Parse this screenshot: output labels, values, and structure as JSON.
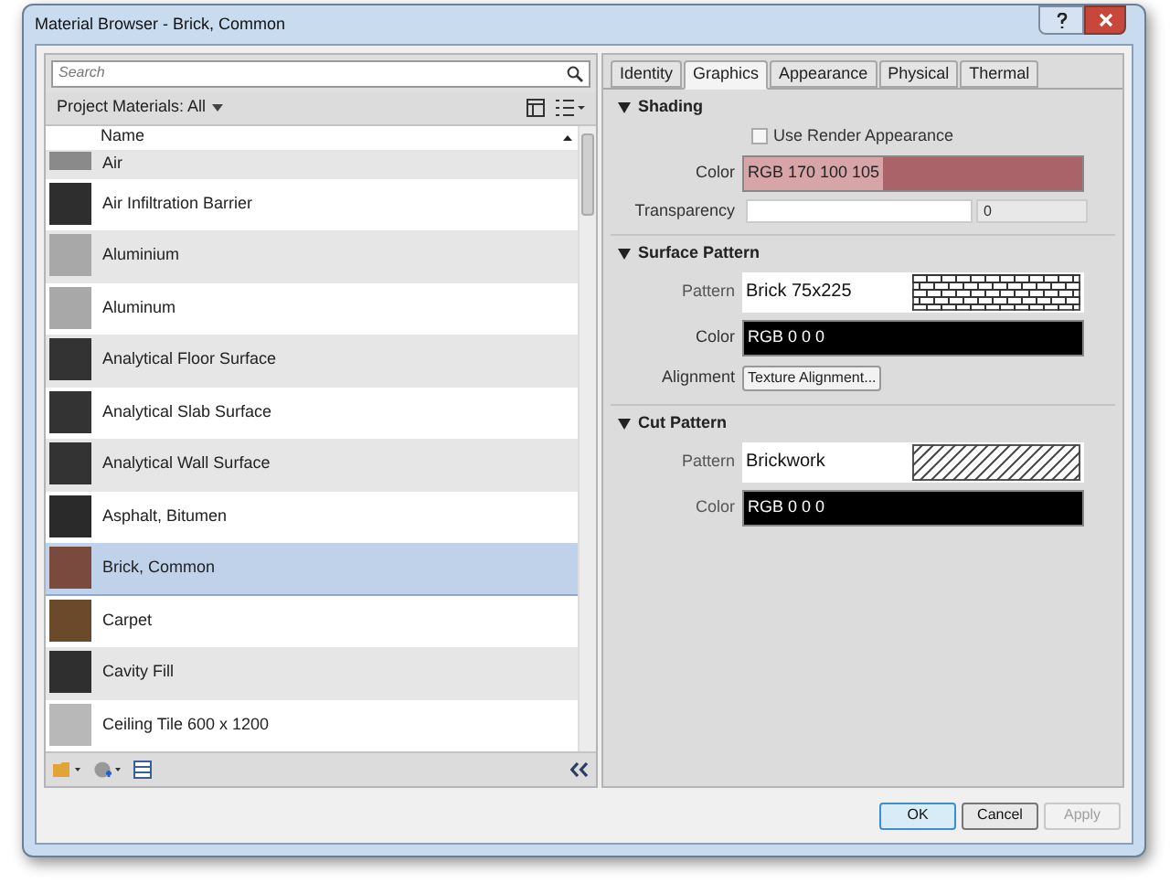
{
  "window": {
    "title": "Material Browser - Brick, Common"
  },
  "browser": {
    "search": {
      "placeholder": "Search"
    },
    "filter": "Project Materials: All",
    "column": "Name",
    "materials": [
      {
        "name": "Air",
        "selected": false,
        "color": "#8a8a8a"
      },
      {
        "name": "Air Infiltration Barrier",
        "selected": false,
        "color": "#2e2e2e"
      },
      {
        "name": "Aluminium",
        "selected": false,
        "color": "#a8a8a8"
      },
      {
        "name": "Aluminum",
        "selected": false,
        "color": "#a8a8a8"
      },
      {
        "name": "Analytical Floor Surface",
        "selected": false,
        "color": "#333333"
      },
      {
        "name": "Analytical Slab Surface",
        "selected": false,
        "color": "#333333"
      },
      {
        "name": "Analytical Wall Surface",
        "selected": false,
        "color": "#333333"
      },
      {
        "name": "Asphalt, Bitumen",
        "selected": false,
        "color": "#2a2a2a"
      },
      {
        "name": "Brick, Common",
        "selected": true,
        "color": "#7a4a3e"
      },
      {
        "name": "Carpet",
        "selected": false,
        "color": "#6b4a2c"
      },
      {
        "name": "Cavity Fill",
        "selected": false,
        "color": "#2f2f2f"
      },
      {
        "name": "Ceiling Tile 600 x 1200",
        "selected": false,
        "color": "#b8b8b8"
      }
    ]
  },
  "tabs": [
    {
      "label": "Identity",
      "selected": false
    },
    {
      "label": "Graphics",
      "selected": true
    },
    {
      "label": "Appearance",
      "selected": false
    },
    {
      "label": "Physical",
      "selected": false
    },
    {
      "label": "Thermal",
      "selected": false
    }
  ],
  "shading": {
    "title": "Shading",
    "use_render_appearance": {
      "label": "Use Render Appearance",
      "checked": false
    },
    "color_label": "Color",
    "color": {
      "value": "RGB 170 100 105",
      "color": "#aa6469"
    },
    "transparency_label": "Transparency",
    "transparency": {
      "reading": "0"
    }
  },
  "surface_pattern": {
    "title": "Surface Pattern",
    "pattern_label": "Pattern",
    "pattern": {
      "name": "Brick 75x225",
      "kind": "brick"
    },
    "color_label": "Color",
    "color": {
      "value": "RGB 0 0 0",
      "color": "#000000"
    },
    "alignment_label": "Alignment",
    "alignment_button": "Texture Alignment..."
  },
  "cut_pattern": {
    "title": "Cut Pattern",
    "pattern_label": "Pattern",
    "pattern": {
      "name": "Brickwork",
      "kind": "hatch"
    },
    "color_label": "Color",
    "color": {
      "value": "RGB 0 0 0",
      "color": "#000000"
    }
  },
  "buttons": [
    {
      "label": "OK",
      "kind": "default",
      "disabled": false
    },
    {
      "label": "Cancel",
      "kind": "normal",
      "disabled": false
    },
    {
      "label": "Apply",
      "kind": "normal",
      "disabled": true
    }
  ]
}
